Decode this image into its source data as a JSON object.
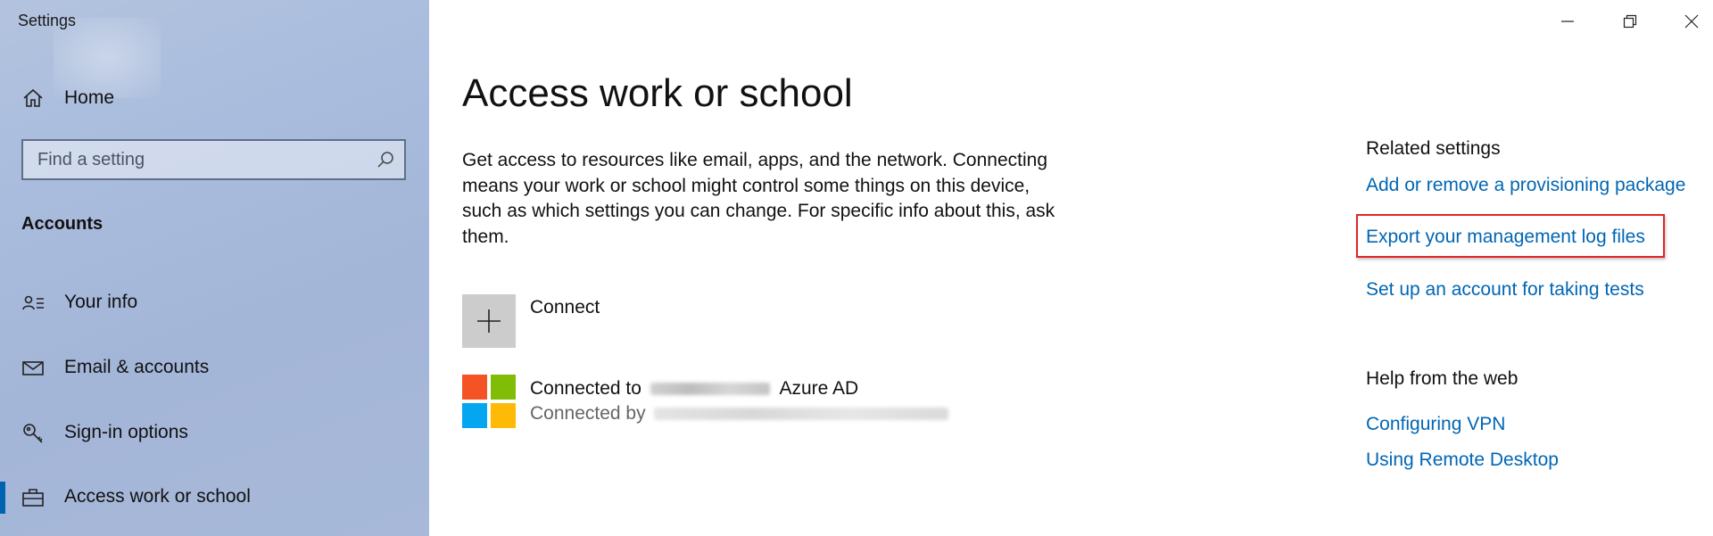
{
  "window": {
    "app_title": "Settings",
    "controls": [
      {
        "name": "minimize",
        "icon": "minimize-icon"
      },
      {
        "name": "restore",
        "icon": "restore-icon"
      },
      {
        "name": "close",
        "icon": "close-icon"
      }
    ]
  },
  "sidebar": {
    "home": {
      "label": "Home",
      "icon": "home-icon"
    },
    "search": {
      "placeholder": "Find a setting",
      "icon": "search-icon"
    },
    "section_heading": "Accounts",
    "items": [
      {
        "label": "Your info",
        "icon": "person-card-icon",
        "selected": false
      },
      {
        "label": "Email & accounts",
        "icon": "mail-icon",
        "selected": false
      },
      {
        "label": "Sign-in options",
        "icon": "key-icon",
        "selected": false
      },
      {
        "label": "Access work or school",
        "icon": "briefcase-icon",
        "selected": true
      }
    ],
    "accent_color": "#0063b1"
  },
  "main": {
    "title": "Access work or school",
    "description": "Get access to resources like email, apps, and the network. Connecting means your work or school might control some things on this device, such as which settings you can change. For specific info about this, ask them.",
    "connect": {
      "label": "Connect",
      "icon": "plus-icon"
    },
    "account": {
      "icon": "microsoft-logo-icon",
      "line1_prefix": "Connected to",
      "line1_suffix": "Azure AD",
      "line2_prefix": "Connected by"
    }
  },
  "related": {
    "heading": "Related settings",
    "links": [
      {
        "label": "Add or remove a provisioning package"
      },
      {
        "label": "Export your management log files",
        "highlighted": true
      },
      {
        "label": "Set up an account for taking tests"
      }
    ],
    "help_heading": "Help from the web",
    "help_links": [
      {
        "label": "Configuring VPN"
      },
      {
        "label": "Using Remote Desktop"
      }
    ],
    "link_color": "#0066b4",
    "highlight_color": "#e0262a"
  }
}
